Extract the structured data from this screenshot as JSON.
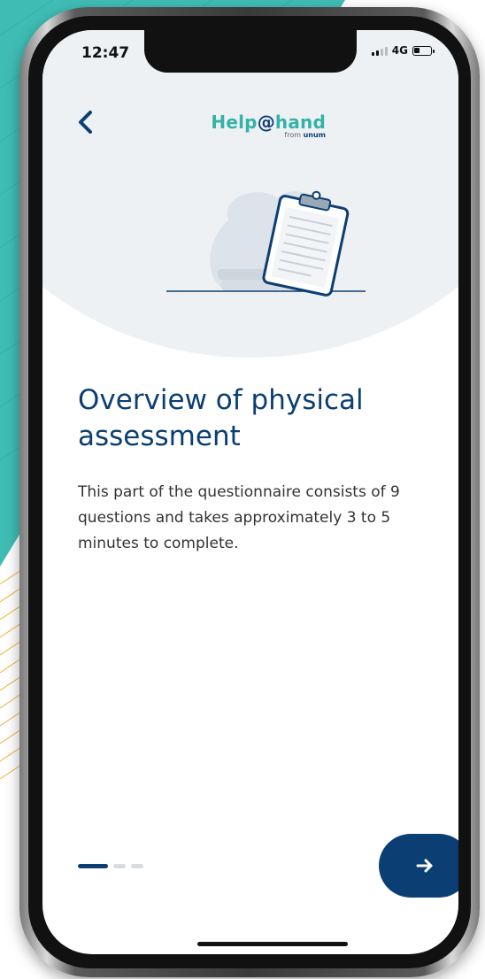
{
  "status_bar": {
    "time": "12:47",
    "network": "4G"
  },
  "header": {
    "logo_prefix": "Help",
    "logo_at": "@",
    "logo_suffix": "hand",
    "logo_from": "from",
    "logo_brand": "unum"
  },
  "content": {
    "title": "Overview of physical assessment",
    "description": "This part of the questionnaire consists of 9 questions and takes approximately 3 to 5 minutes to complete."
  },
  "pagination": {
    "total": 3,
    "current": 1
  },
  "colors": {
    "primary": "#0b3f73",
    "accent": "#35b2a8",
    "hero_bg": "#eef1f4"
  },
  "icons": {
    "back": "chevron-left-icon",
    "next": "arrow-right-icon",
    "illustration": "clipboard-illustration"
  }
}
